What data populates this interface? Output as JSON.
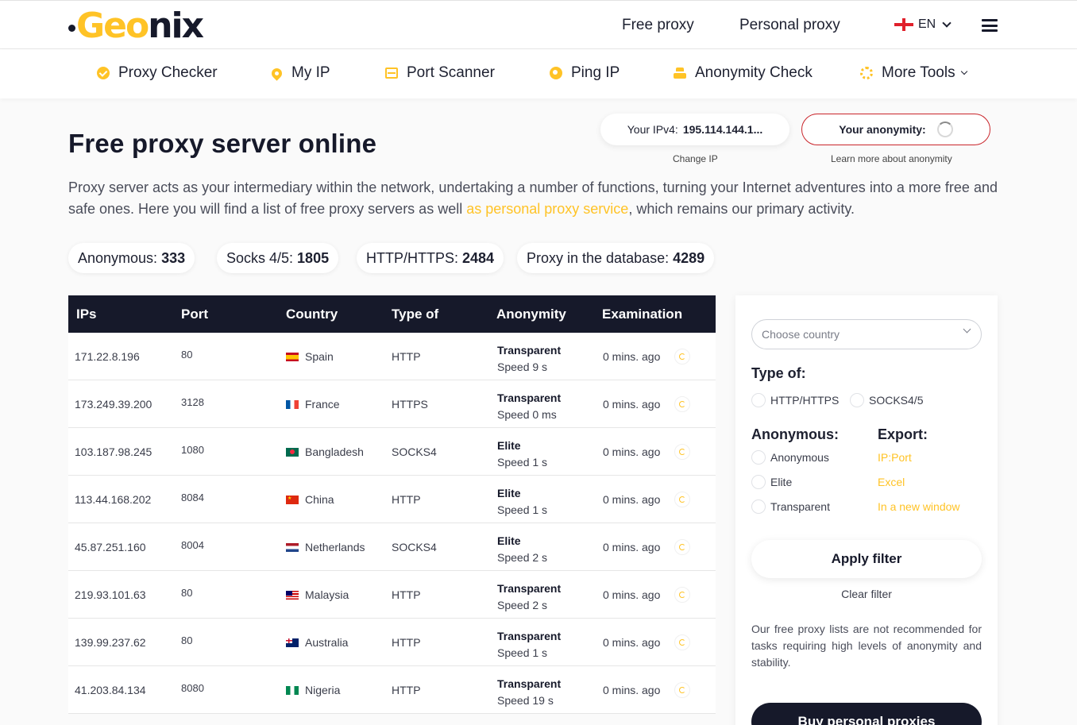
{
  "header": {
    "logo_prefix": "Geo",
    "logo_suffix": "nix",
    "links": [
      "Free proxy",
      "Personal proxy"
    ],
    "lang": "EN"
  },
  "tools": [
    {
      "label": "Proxy Checker",
      "icon": "check-circle-icon"
    },
    {
      "label": "My IP",
      "icon": "location-pin-icon"
    },
    {
      "label": "Port Scanner",
      "icon": "scanner-icon"
    },
    {
      "label": "Ping IP",
      "icon": "ping-icon"
    },
    {
      "label": "Anonymity Check",
      "icon": "anonymity-icon"
    },
    {
      "label": "More Tools",
      "icon": "dots-circle-icon"
    }
  ],
  "hero": {
    "title": "Free proxy server online",
    "ip_label": "Your IPv4:",
    "ip_value": "195.114.144.1...",
    "change_ip": "Change IP",
    "anonymity_label": "Your anonymity:",
    "anonymity_link": "Learn more about anonymity",
    "intro_before": "Proxy server acts as your intermediary within the network, undertaking a number of functions, turning your Internet adventures into a more free and safe ones. Here you will find a list of free proxy servers as well ",
    "intro_link": "as personal proxy service",
    "intro_after": ", which remains our primary activity."
  },
  "stats": [
    {
      "label": "Anonymous:",
      "value": "333"
    },
    {
      "label": "Socks 4/5:",
      "value": "1805"
    },
    {
      "label": "HTTP/HTTPS:",
      "value": "2484"
    },
    {
      "label": "Proxy in the database:",
      "value": "4289"
    }
  ],
  "table": {
    "headers": [
      "IPs",
      "Port",
      "Country",
      "Type of",
      "Anonymity",
      "Examination"
    ],
    "rows": [
      {
        "ip": "171.22.8.196",
        "port": "80",
        "country": "Spain",
        "flag": "es",
        "type": "HTTP",
        "anonymity": "Transparent",
        "speed": "Speed 9 s",
        "exam": "0 mins. ago"
      },
      {
        "ip": "173.249.39.200",
        "port": "3128",
        "country": "France",
        "flag": "fr",
        "type": "HTTPS",
        "anonymity": "Transparent",
        "speed": "Speed 0 ms",
        "exam": "0 mins. ago"
      },
      {
        "ip": "103.187.98.245",
        "port": "1080",
        "country": "Bangladesh",
        "flag": "bd",
        "type": "SOCKS4",
        "anonymity": "Elite",
        "speed": "Speed 1 s",
        "exam": "0 mins. ago"
      },
      {
        "ip": "113.44.168.202",
        "port": "8084",
        "country": "China",
        "flag": "cn",
        "type": "HTTP",
        "anonymity": "Elite",
        "speed": "Speed 1 s",
        "exam": "0 mins. ago"
      },
      {
        "ip": "45.87.251.160",
        "port": "8004",
        "country": "Netherlands",
        "flag": "nl",
        "type": "SOCKS4",
        "anonymity": "Elite",
        "speed": "Speed 2 s",
        "exam": "0 mins. ago"
      },
      {
        "ip": "219.93.101.63",
        "port": "80",
        "country": "Malaysia",
        "flag": "my",
        "type": "HTTP",
        "anonymity": "Transparent",
        "speed": "Speed 2 s",
        "exam": "0 mins. ago"
      },
      {
        "ip": "139.99.237.62",
        "port": "80",
        "country": "Australia",
        "flag": "au",
        "type": "HTTP",
        "anonymity": "Transparent",
        "speed": "Speed 1 s",
        "exam": "0 mins. ago"
      },
      {
        "ip": "41.203.84.134",
        "port": "8080",
        "country": "Nigeria",
        "flag": "ng",
        "type": "HTTP",
        "anonymity": "Transparent",
        "speed": "Speed 19 s",
        "exam": "0 mins. ago"
      }
    ]
  },
  "filter": {
    "country_placeholder": "Choose country",
    "type_title": "Type of:",
    "type_options": [
      "HTTP/HTTPS",
      "SOCKS4/5"
    ],
    "anon_title": "Anonymous:",
    "anon_options": [
      "Anonymous",
      "Elite",
      "Transparent"
    ],
    "export_title": "Export:",
    "export_options": [
      "IP:Port",
      "Excel",
      "In a new window"
    ],
    "apply": "Apply filter",
    "clear": "Clear filter",
    "note": "Our free proxy lists are not recommended for tasks requiring high levels of anonymity and stability.",
    "buy": "Buy personal proxies"
  },
  "colors": {
    "accent": "#ffc326",
    "dark": "#16192a",
    "danger": "#c9252b"
  }
}
